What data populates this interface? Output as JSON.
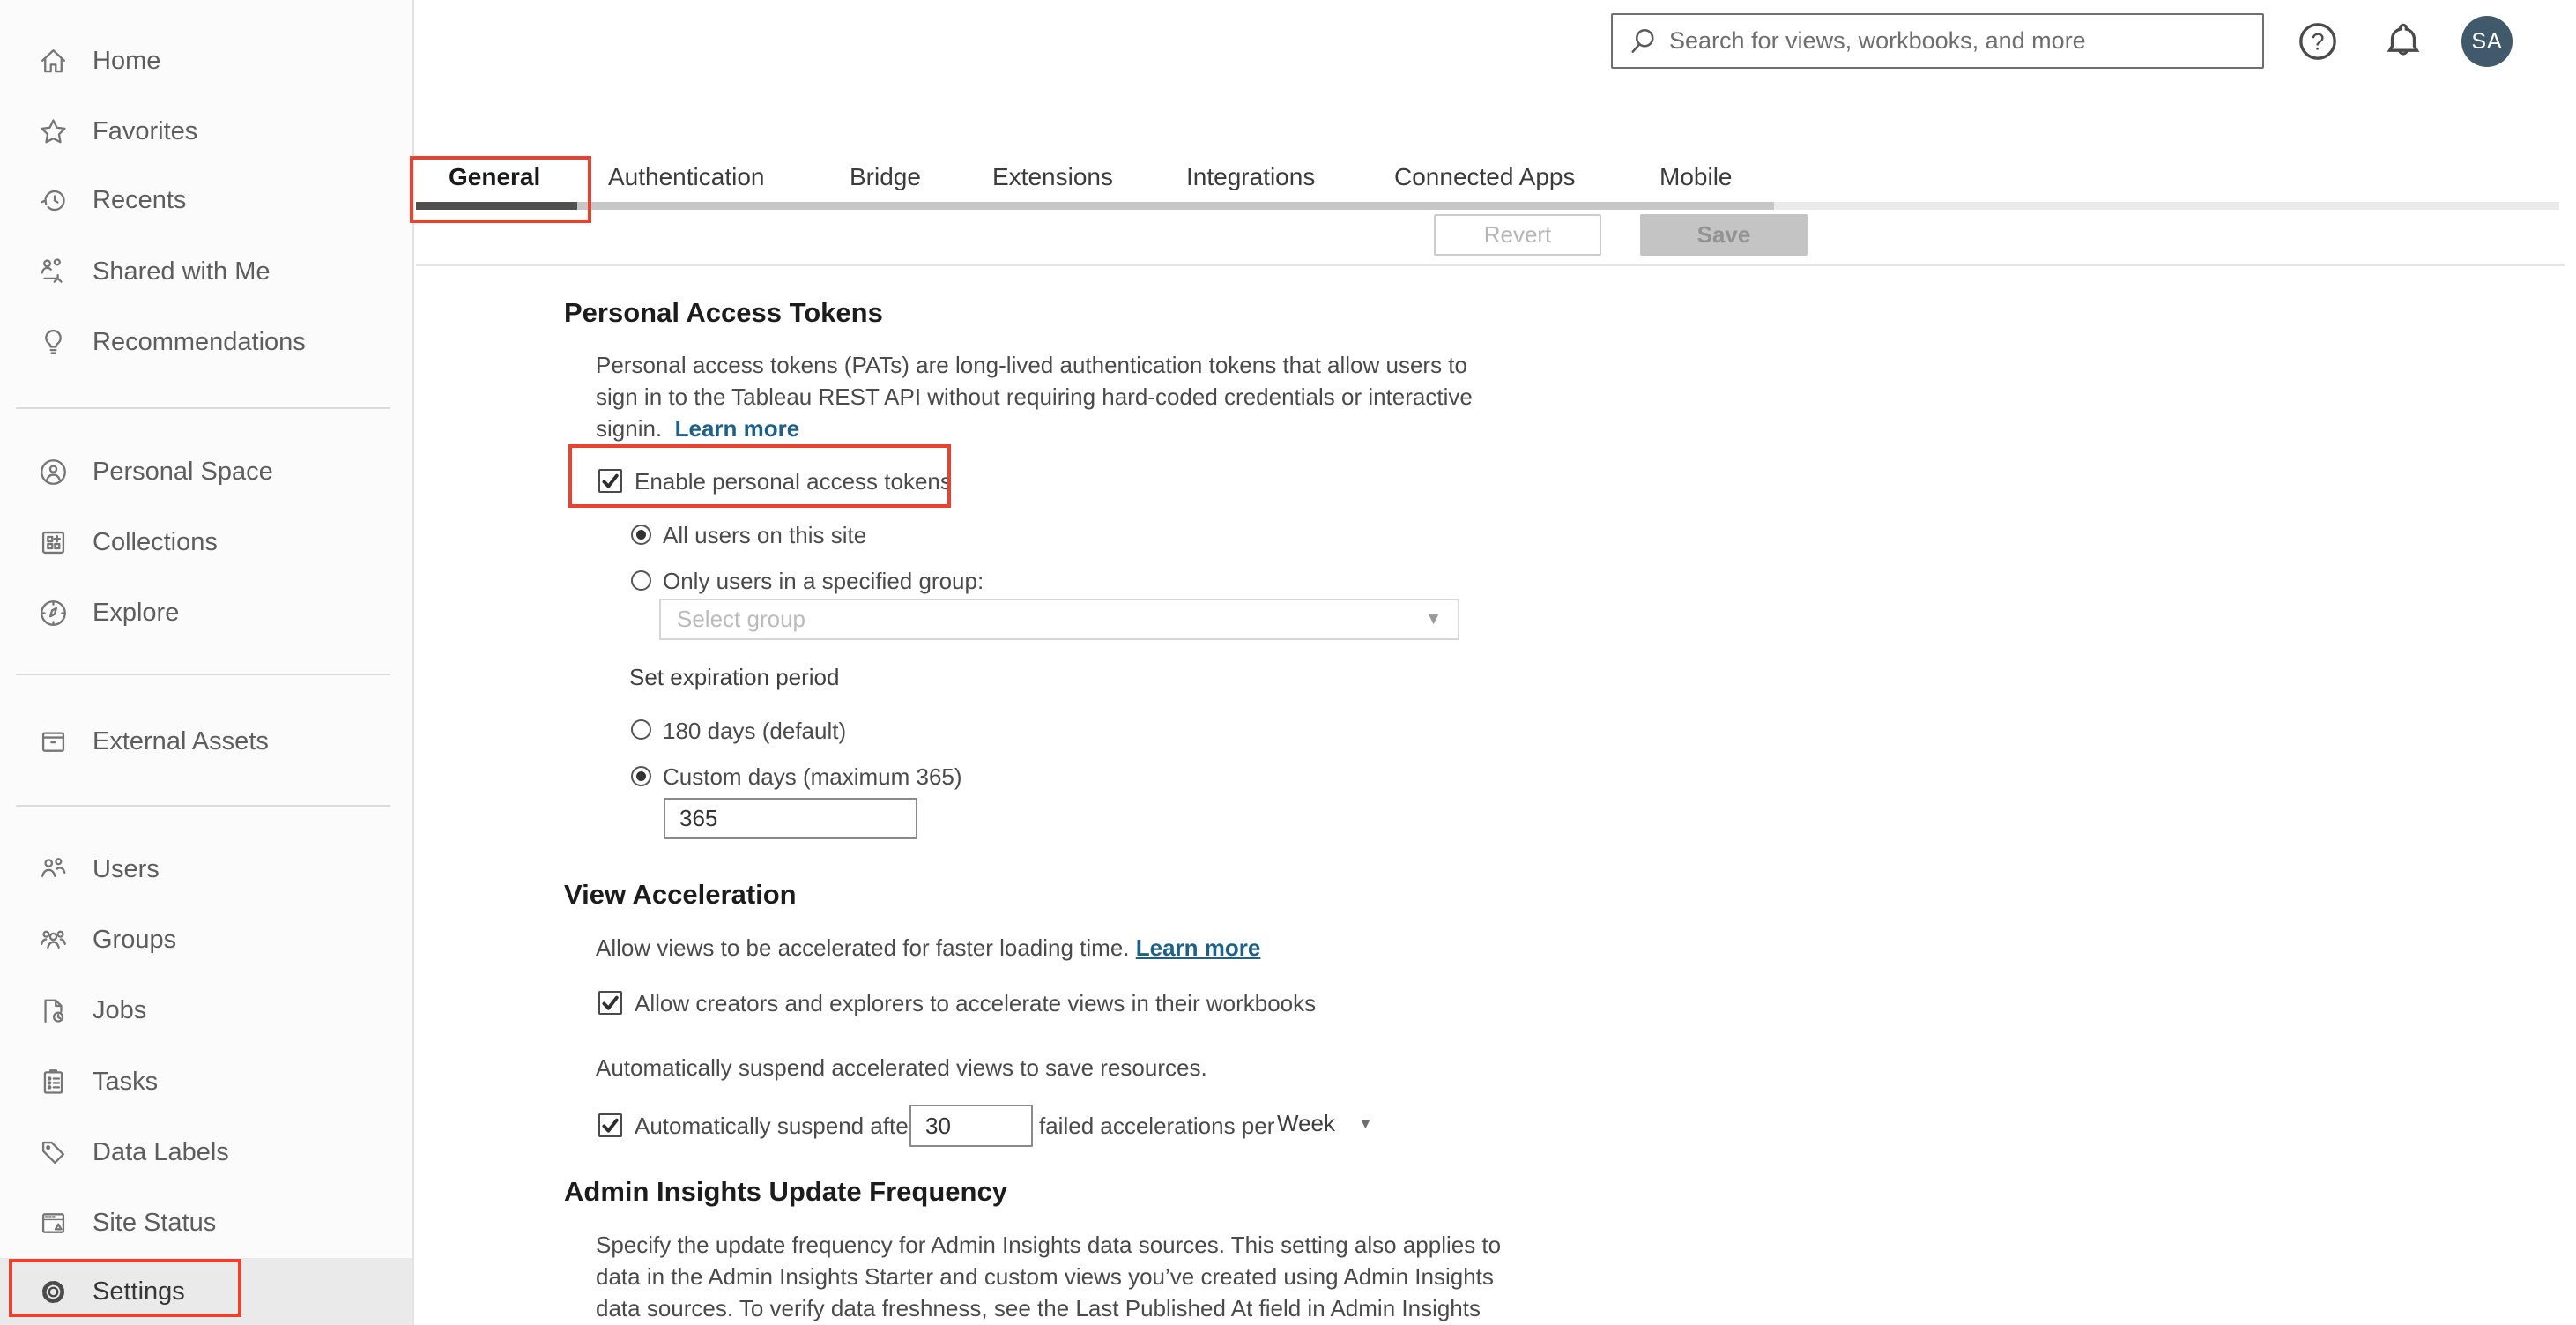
{
  "topbar": {
    "search_placeholder": "Search for views, workbooks, and more",
    "avatar_initials": "SA"
  },
  "sidebar": {
    "items": [
      {
        "label": "Home",
        "icon": "home-icon"
      },
      {
        "label": "Favorites",
        "icon": "star-icon"
      },
      {
        "label": "Recents",
        "icon": "recents-clock-icon"
      },
      {
        "label": "Shared with Me",
        "icon": "shared-with-me-icon"
      },
      {
        "label": "Recommendations",
        "icon": "lightbulb-icon"
      },
      {
        "label": "Personal Space",
        "icon": "person-circle-icon"
      },
      {
        "label": "Collections",
        "icon": "collections-grid-icon"
      },
      {
        "label": "Explore",
        "icon": "compass-icon"
      },
      {
        "label": "External Assets",
        "icon": "drawer-icon"
      },
      {
        "label": "Users",
        "icon": "users-icon"
      },
      {
        "label": "Groups",
        "icon": "groups-icon"
      },
      {
        "label": "Jobs",
        "icon": "document-clock-icon"
      },
      {
        "label": "Tasks",
        "icon": "clipboard-icon"
      },
      {
        "label": "Data Labels",
        "icon": "tag-icon"
      },
      {
        "label": "Site Status",
        "icon": "window-status-icon"
      },
      {
        "label": "Settings",
        "icon": "gear-icon"
      }
    ],
    "selected": "Settings"
  },
  "tabs": {
    "items": [
      "General",
      "Authentication",
      "Bridge",
      "Extensions",
      "Integrations",
      "Connected Apps",
      "Mobile"
    ],
    "active": "General"
  },
  "actions": {
    "revert_label": "Revert",
    "save_label": "Save"
  },
  "sections": {
    "pat": {
      "title": "Personal Access Tokens",
      "desc_line1": "Personal access tokens (PATs) are long-lived authentication tokens that allow users to",
      "desc_line2": "sign in to the Tableau REST API without requiring hard-coded credentials or interactive",
      "desc_line3": "signin.",
      "learn_more": "Learn more",
      "enable_label": "Enable personal access tokens",
      "enable_checked": true,
      "radio_all_users": "All users on this site",
      "radio_all_users_selected": true,
      "radio_specified_group": "Only users in a specified group:",
      "select_group_placeholder": "Select group",
      "expiration_label": "Set expiration period",
      "radio_180": "180 days (default)",
      "radio_custom": "Custom days (maximum 365)",
      "radio_custom_selected": true,
      "custom_days_value": "365"
    },
    "view_acceleration": {
      "title": "View Acceleration",
      "description": "Allow views to be accelerated for faster loading time.",
      "learn_more": "Learn more",
      "allow_label": "Allow creators and explorers to accelerate views in their workbooks",
      "allow_checked": true,
      "suspend_description": "Automatically suspend accelerated views to save resources.",
      "suspend_after_label": "Automatically suspend after",
      "suspend_checked": true,
      "suspend_value": "30",
      "suspend_suffix": "failed accelerations per",
      "period_value": "Week"
    },
    "admin_insights": {
      "title": "Admin Insights Update Frequency",
      "desc_line1": "Specify the update frequency for Admin Insights data sources. This setting also applies to",
      "desc_line2": "data in the Admin Insights Starter and custom views you’ve created using Admin Insights",
      "desc_line3": "data sources. To verify data freshness, see the Last Published At field in Admin Insights"
    }
  },
  "colors": {
    "annotation_red": "#e9422e",
    "link_blue": "#1f6086",
    "avatar_bg": "#40596b",
    "active_tab_underline": "#4f4f4f",
    "selected_row_bg": "#eaeaea"
  }
}
